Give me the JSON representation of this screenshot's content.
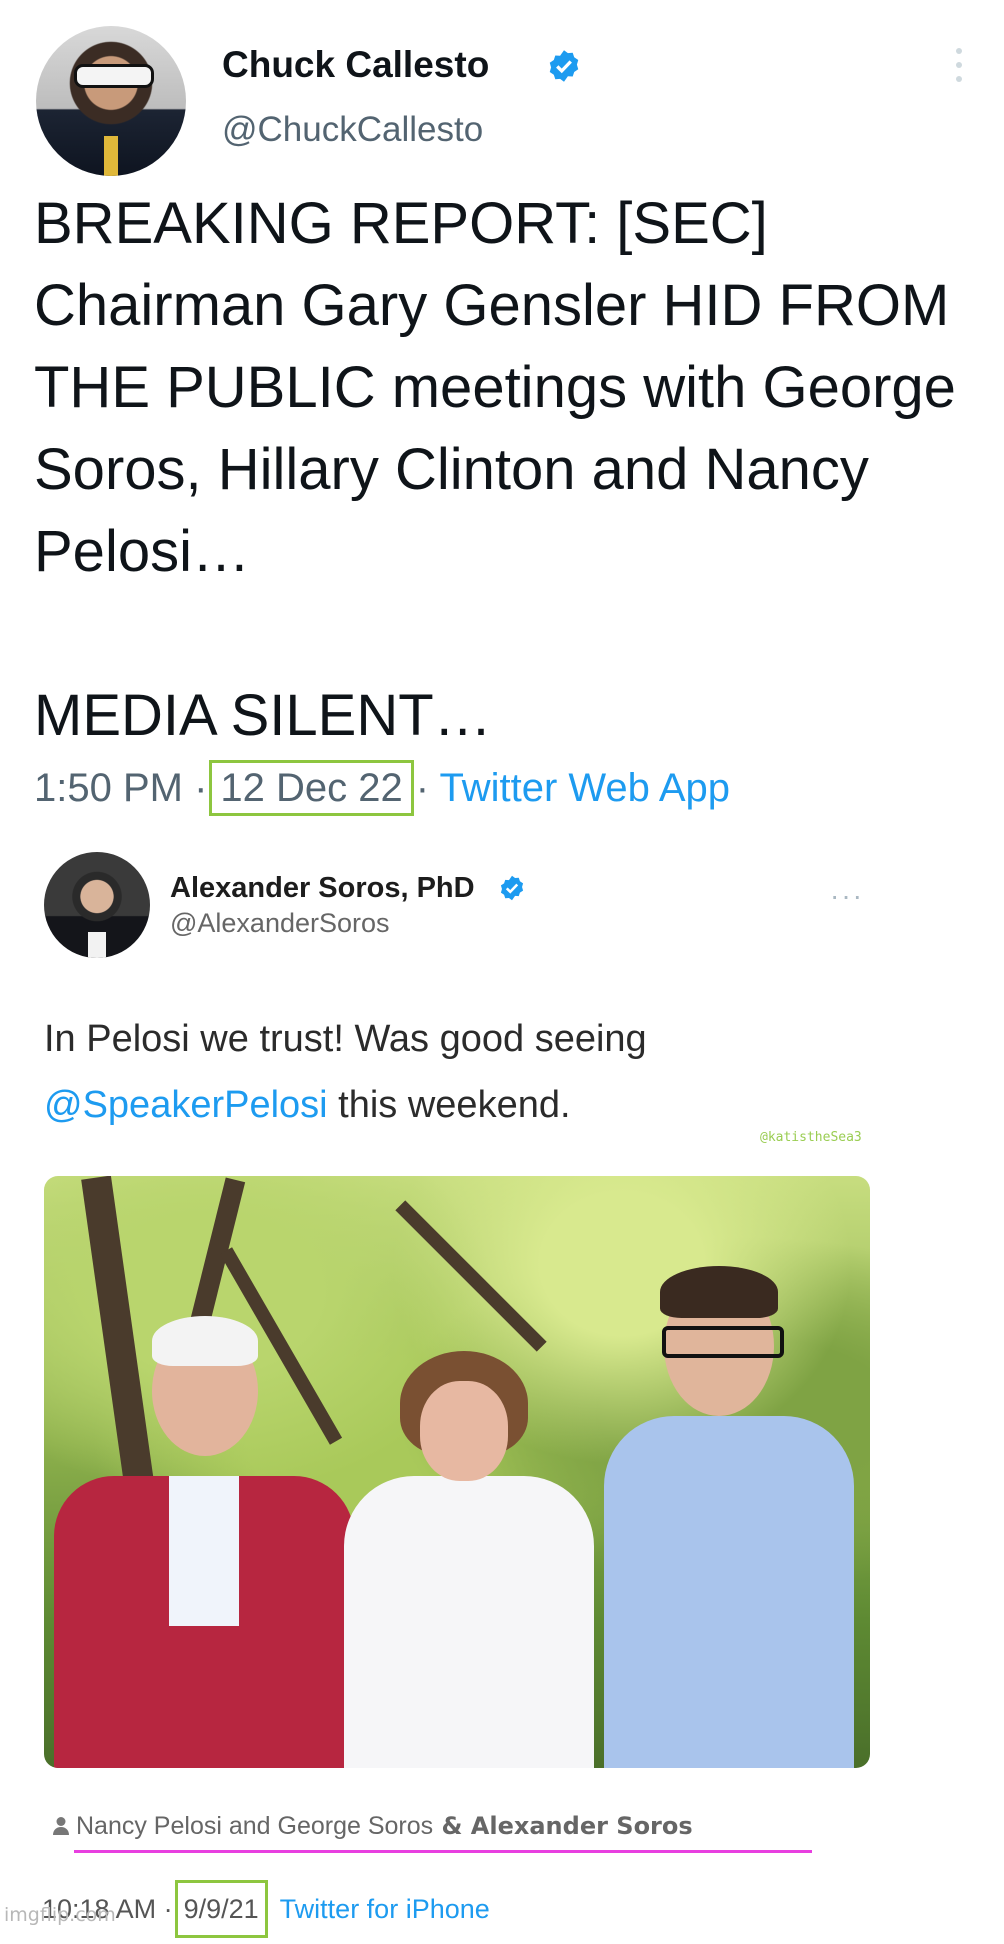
{
  "outer_tweet": {
    "author_name": "Chuck Callesto",
    "handle": "@ChuckCallesto",
    "text": "BREAKING REPORT: [SEC] Chairman Gary Gensler HID FROM THE PUBLIC meetings with George Soros, Hillary Clinton and Nancy Pelosi…\n\nMEDIA SILENT…",
    "time": "1:50 PM",
    "separator": "·",
    "date": "12 Dec 22",
    "source": "Twitter Web App"
  },
  "inner_tweet": {
    "author_name": "Alexander Soros, PhD",
    "handle": "@AlexanderSoros",
    "more": "···",
    "text_line1": "In Pelosi we trust! Was good seeing",
    "mention": "@SpeakerPelosi",
    "text_line2_rest": " this weekend.",
    "watermark": "@katistheSea3",
    "tagged": "Nancy Pelosi and George Soros",
    "tagged_extra": " & Alexander Soros",
    "time": "10:18 AM",
    "separator": "·",
    "date": "9/9/21",
    "source": "Twitter for iPhone"
  },
  "site_watermark": "imgflip.com",
  "icons": [
    "verified-badge-icon",
    "more-options-icon",
    "person-tag-icon"
  ],
  "colors": {
    "link_blue": "#1d9bf0",
    "highlight_green": "#8dc63f",
    "underline_magenta": "#e83fe0"
  }
}
